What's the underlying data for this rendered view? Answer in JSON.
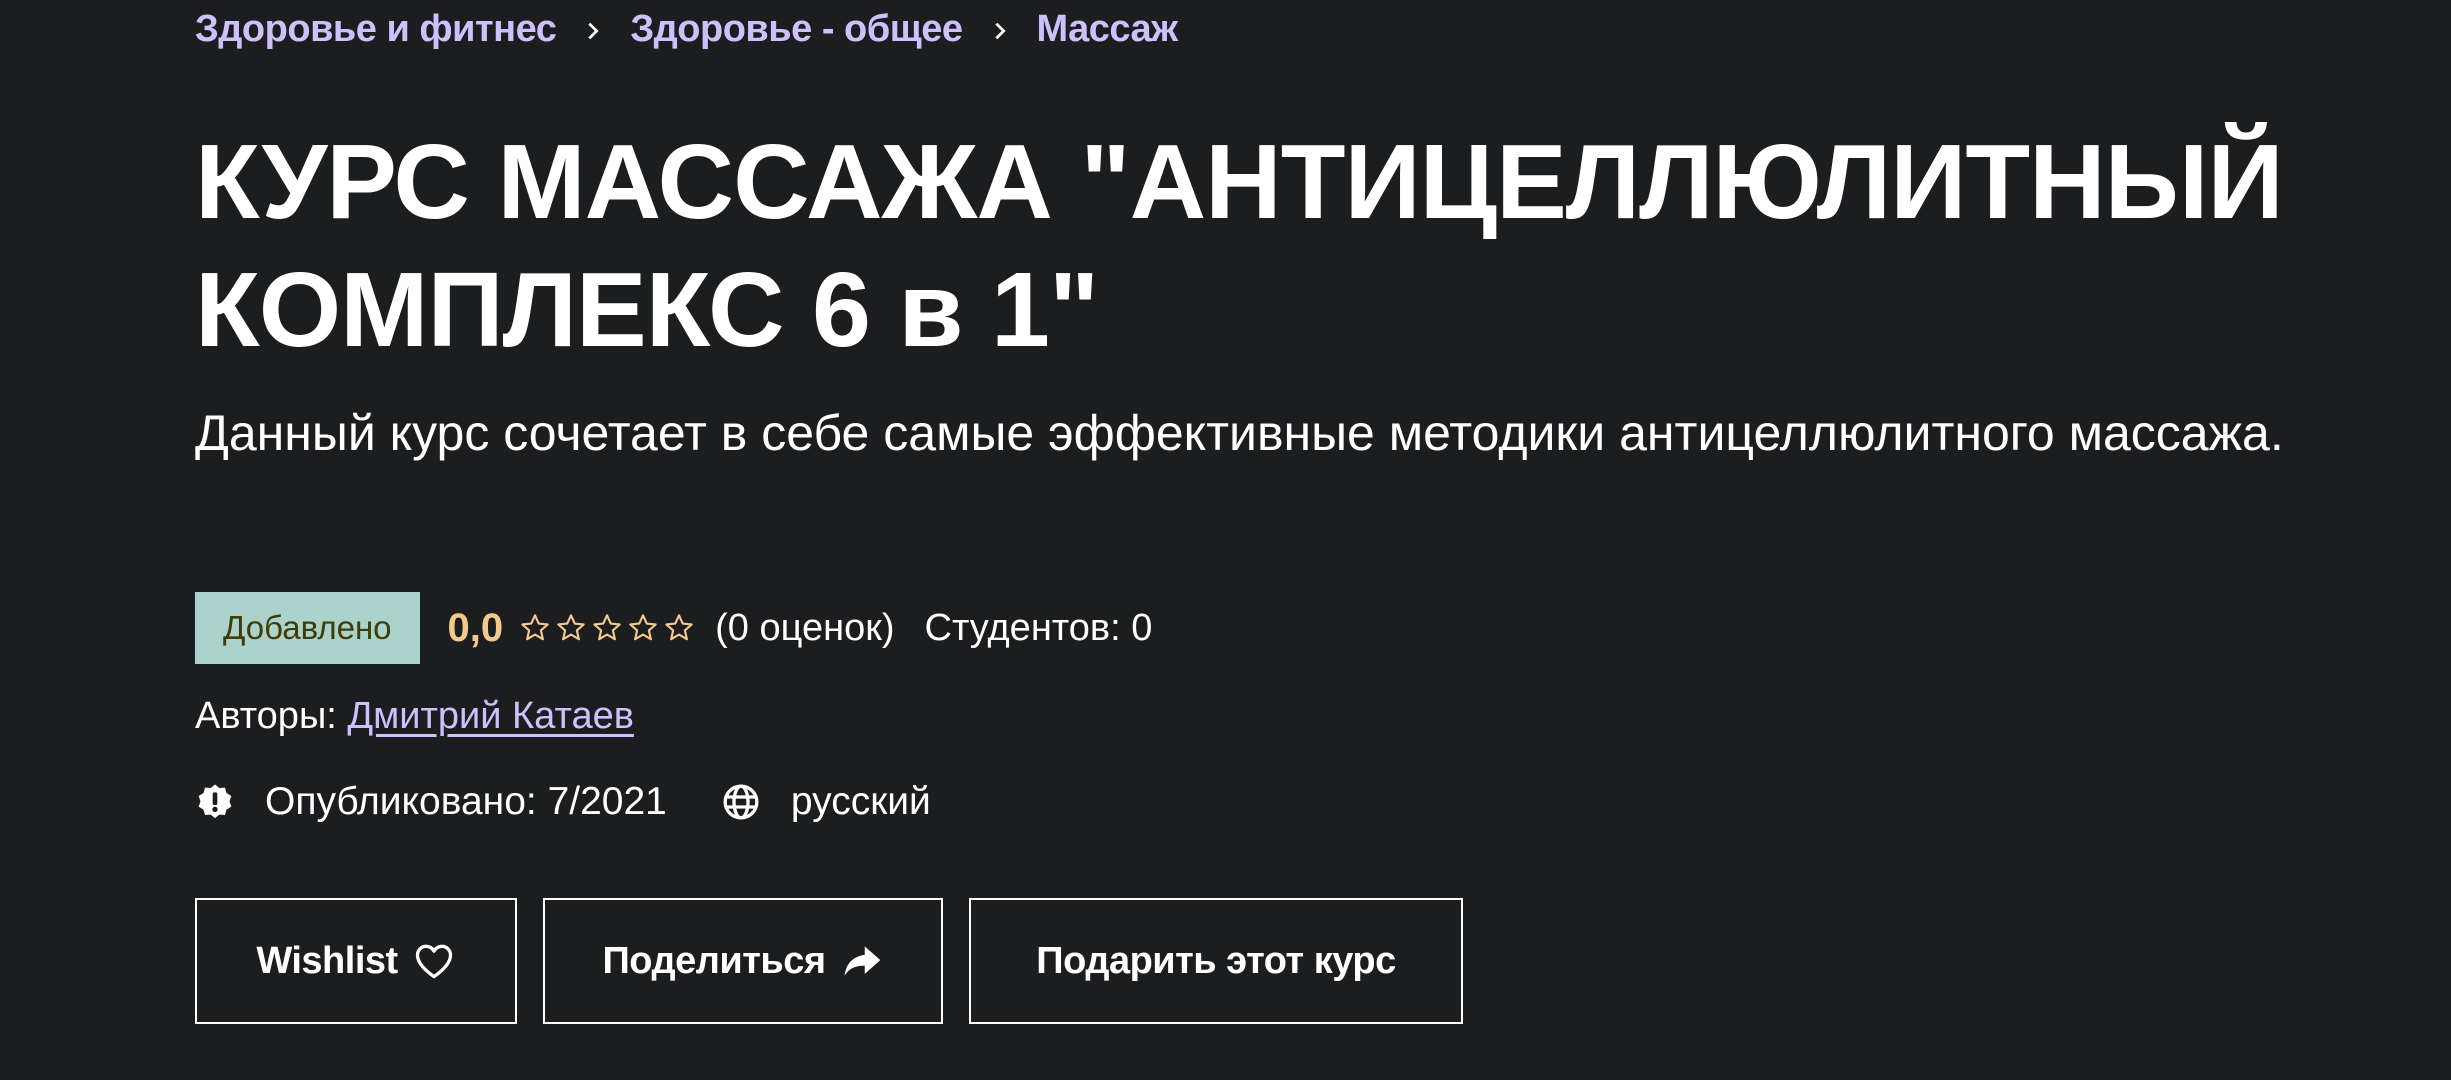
{
  "breadcrumb": {
    "items": [
      "Здоровье и фитнес",
      "Здоровье - общее",
      "Массаж"
    ],
    "separator_icon": "chevron-right-icon"
  },
  "course": {
    "title": "КУРС МАССАЖА \"АНТИЦЕЛЛЮЛИТНЫЙ КОМПЛЕКС 6 в 1\"",
    "subtitle": "Данный курс сочетает в себе самые эффективные методики антицеллюлитного массажа."
  },
  "rating": {
    "badge": "Добавлено",
    "value": "0,0",
    "stars_total": 5,
    "stars_filled": 0,
    "count": "(0 оценок)",
    "students": "Студентов: 0"
  },
  "authors": {
    "label": "Авторы:",
    "name": "Дмитрий Катаев"
  },
  "meta": {
    "published": "Опубликовано: 7/2021",
    "published_icon": "alert-badge-icon",
    "language": "русский",
    "language_icon": "globe-icon"
  },
  "buttons": {
    "wishlist": "Wishlist",
    "wishlist_icon": "heart-icon",
    "share": "Поделиться",
    "share_icon": "share-arrow-icon",
    "gift": "Подарить этот курс"
  },
  "colors": {
    "background": "#1c1d1f",
    "link": "#cec0fc",
    "rating": "#f3ca8c",
    "badge_bg": "#acd2cc",
    "badge_text": "#3d3c0a"
  }
}
